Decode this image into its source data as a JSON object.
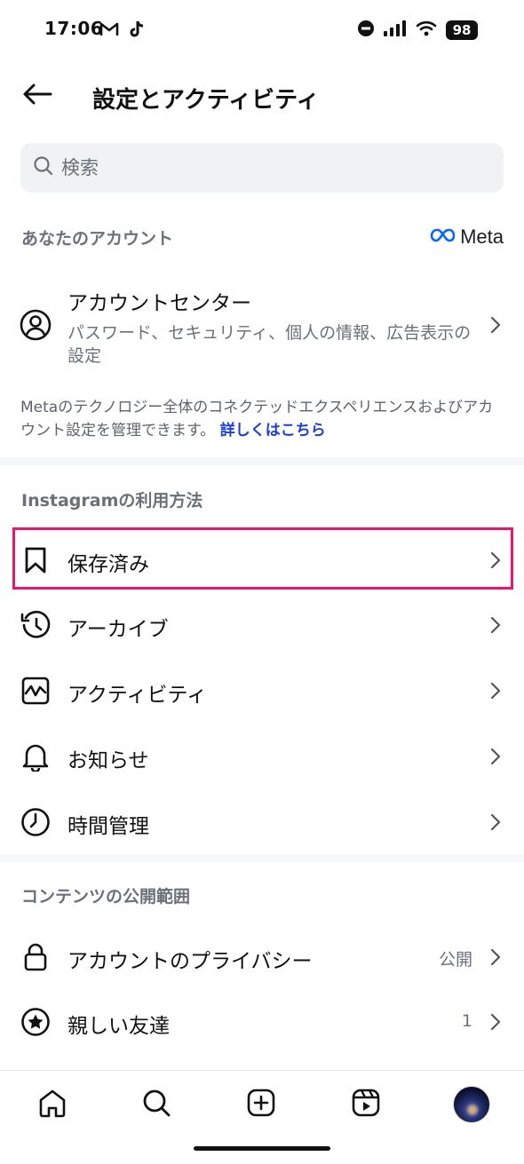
{
  "status_bar": {
    "time": "17:06",
    "battery": "98",
    "icons": [
      "gmail-icon",
      "tiktok-icon",
      "do-not-disturb-icon",
      "signal-icon",
      "wifi-icon"
    ]
  },
  "header": {
    "title": "設定とアクティビティ",
    "back_icon": "arrow-left-icon"
  },
  "search": {
    "placeholder": "検索"
  },
  "your_account": {
    "section_title": "あなたのアカウント",
    "meta_logo": "Meta",
    "account_center": {
      "title": "アカウントセンター",
      "subtitle": "パスワード、セキュリティ、個人の情報、広告表示の設定"
    },
    "note": "Metaのテクノロジー全体のコネクテッドエクスペリエンスおよびアカウント設定を管理できます。",
    "note_link": "詳しくはこちら"
  },
  "how_you_use": {
    "section_title": "Instagramの利用方法",
    "items": [
      {
        "label": "保存済み",
        "icon": "bookmark-icon"
      },
      {
        "label": "アーカイブ",
        "icon": "archive-icon"
      },
      {
        "label": "アクティビティ",
        "icon": "activity-icon"
      },
      {
        "label": "お知らせ",
        "icon": "bell-icon"
      },
      {
        "label": "時間管理",
        "icon": "clock-icon"
      }
    ]
  },
  "who_can_see": {
    "section_title": "コンテンツの公開範囲",
    "items": [
      {
        "label": "アカウントのプライバシー",
        "value": "公開",
        "icon": "lock-icon"
      },
      {
        "label": "親しい友達",
        "value": "1",
        "icon": "star-icon"
      }
    ]
  },
  "colors": {
    "highlight": "#e6186f",
    "link": "#1b3ed6",
    "secondary_text": "#6b7079"
  },
  "bottom_nav": [
    "home-icon",
    "search-icon",
    "create-icon",
    "reels-icon",
    "profile-avatar"
  ]
}
